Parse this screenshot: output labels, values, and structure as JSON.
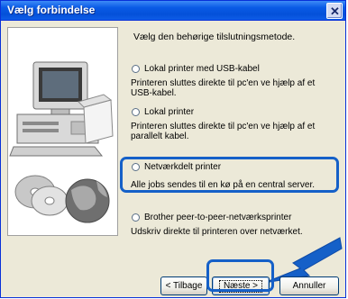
{
  "window": {
    "title": "Vælg forbindelse"
  },
  "instruction": "Vælg den behørige tilslutningsmetode.",
  "options": [
    {
      "label": "Lokal printer med USB-kabel",
      "description": "Printeren sluttes direkte til pc'en ve hjælp af et USB-kabel."
    },
    {
      "label": "Lokal printer",
      "description": "Printeren sluttes direkte til pc'en ve hjælp af et parallelt kabel."
    },
    {
      "label": "Netværkdelt printer",
      "description": "Alle jobs sendes til en kø på en central server."
    },
    {
      "label": "Brother peer-to-peer-netværksprinter",
      "description": "Udskriv direkte til printeren over netværket."
    }
  ],
  "buttons": {
    "back": "< Tilbage",
    "next": "Næste >",
    "cancel": "Annuller"
  },
  "colors": {
    "title_bar": "#0a5be6",
    "highlight": "#1560c8",
    "dialog_bg": "#ece9d8"
  },
  "icons": {
    "close": "close-icon",
    "arrow": "pointer-arrow-icon",
    "illustration": "computer-cd-globe-illustration"
  }
}
